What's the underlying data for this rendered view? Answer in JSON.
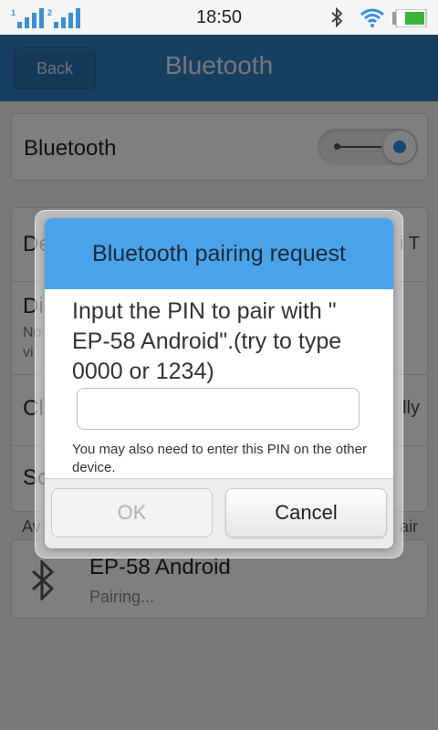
{
  "status_bar": {
    "sim1_label": "1",
    "sim2_label": "2",
    "time": "18:50",
    "icons": [
      "bluetooth-icon",
      "wifi-icon",
      "battery-icon"
    ],
    "battery_color": "#3bb43b"
  },
  "header": {
    "back_label": "Back",
    "title": "Bluetooth",
    "color": "#2f7ec2"
  },
  "settings": {
    "bluetooth_label": "Bluetooth",
    "bluetooth_on": true,
    "row_device_name": "De",
    "row_device_name_value": "i T",
    "row_discoverable": "Di",
    "row_discoverable_sub1": "No",
    "row_discoverable_sub2": "vi",
    "row_check": "Cl",
    "row_check_value": "lly",
    "row_scan": "Sc",
    "available_header": "Av",
    "available_header_right": "air"
  },
  "device": {
    "name": "EP-58 Android",
    "status": "Pairing..."
  },
  "dialog": {
    "title": "Bluetooth pairing request",
    "message": "Input the PIN to pair with \" EP-58 Android\".(try to type 0000 or 1234)",
    "pin_value": "",
    "pin_placeholder": "",
    "note": "You may also need to enter this PIN on the other device.",
    "ok_label": "OK",
    "cancel_label": "Cancel",
    "title_color": "#4aa3ea"
  }
}
